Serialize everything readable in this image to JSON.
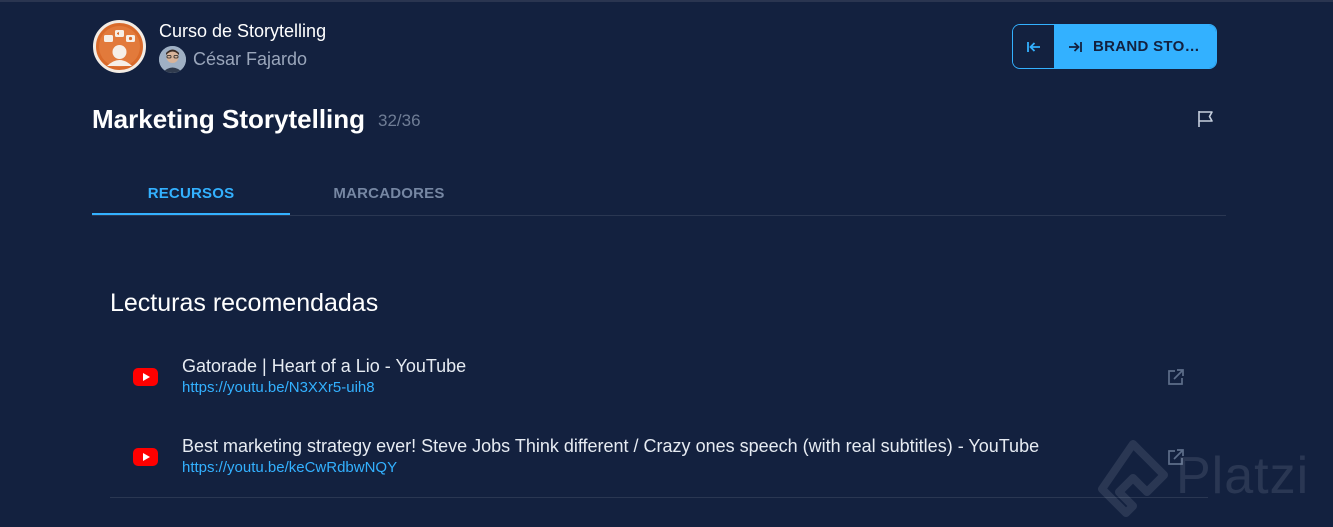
{
  "header": {
    "course_title": "Curso de Storytelling",
    "teacher_name": "César Fajardo",
    "course_badge_icon": "storytelling-course-badge",
    "teacher_avatar_icon": "teacher-avatar"
  },
  "navigation": {
    "prev_icon": "arrow-left-to-bar-icon",
    "next_icon": "arrow-right-to-bar-icon",
    "next_label": "BRAND STO…"
  },
  "class": {
    "title": "Marketing Storytelling",
    "count": "32/36",
    "flag_icon": "flag-icon"
  },
  "tabs": [
    {
      "label": "RECURSOS",
      "active": true
    },
    {
      "label": "MARCADORES",
      "active": false
    }
  ],
  "resources": {
    "section_title": "Lecturas recomendadas",
    "items": [
      {
        "title": "Gatorade | Heart of a Lio - YouTube",
        "url": "https://youtu.be/N3XXr5-uih8",
        "icon": "youtube-icon"
      },
      {
        "title": "Best marketing strategy ever! Steve Jobs Think different / Crazy ones speech (with real subtitles) - YouTube",
        "url": "https://youtu.be/keCwRdbwNQY",
        "icon": "youtube-icon"
      }
    ]
  },
  "watermark": {
    "text": "Platzi"
  },
  "colors": {
    "background": "#13213f",
    "accent": "#33b1ff",
    "muted_text": "#7687a3",
    "youtube_red": "#ff0000"
  }
}
